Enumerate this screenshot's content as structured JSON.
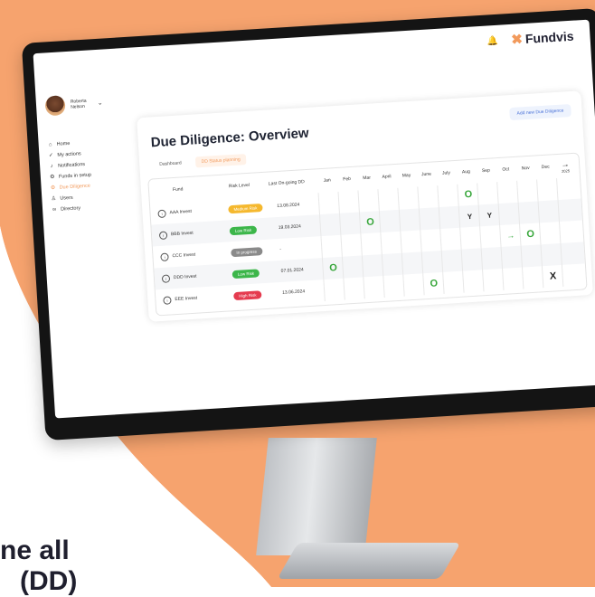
{
  "colors": {
    "background_orange": "#f6a36e",
    "accent": "#f29a5c",
    "badge_medium": "#f5b82e",
    "badge_low": "#3cb64a",
    "badge_progress": "#8a8a8a",
    "badge_high": "#e53b4f",
    "marker_green": "#37a63a"
  },
  "header": {
    "bell_icon": "bell-icon",
    "logo_text": "Fundvis"
  },
  "user": {
    "first_name": "Roberta",
    "last_name": "Nelson"
  },
  "sidebar": {
    "items": [
      {
        "label": "Home",
        "icon": "home-icon"
      },
      {
        "label": "My actions",
        "icon": "check-circle-icon"
      },
      {
        "label": "Notifications",
        "icon": "bell-icon"
      },
      {
        "label": "Funds in setup",
        "icon": "gear-icon"
      },
      {
        "label": "Due Diligence",
        "icon": "gear-icon",
        "active": true
      },
      {
        "label": "Users",
        "icon": "users-icon"
      },
      {
        "label": "Directory",
        "icon": "link-icon"
      }
    ]
  },
  "main": {
    "title": "Due Diligence: Overview",
    "add_button": "Add new Due Diligence",
    "tabs": [
      "Dashboard",
      "DD Status planning"
    ],
    "table": {
      "headers": [
        "Fund",
        "Risk Level",
        "Last On-going DD"
      ],
      "months": [
        "Jan",
        "Feb",
        "Mar",
        "April",
        "May",
        "June",
        "July",
        "Aug",
        "Sep",
        "Oct",
        "Nov",
        "Dec"
      ],
      "next_year": "2025",
      "rows": [
        {
          "fund": "AAA Invest",
          "risk": "Medium Risk",
          "risk_color": "#f5b82e",
          "date": "13.08.2024",
          "marks": {
            "7": "O"
          }
        },
        {
          "fund": "BBB Invest",
          "risk": "Low Risk",
          "risk_color": "#3cb64a",
          "date": "19.03.2024",
          "marks": {
            "2": "O",
            "7": "Y",
            "8": "Y"
          }
        },
        {
          "fund": "CCC Invest",
          "risk": "In progress",
          "risk_color": "#8a8a8a",
          "date": "-",
          "marks": {
            "9": "→",
            "10": "O"
          }
        },
        {
          "fund": "DDD Invest",
          "risk": "Low Risk",
          "risk_color": "#3cb64a",
          "date": "07.01.2024",
          "marks": {
            "0": "O"
          }
        },
        {
          "fund": "EEE Invest",
          "risk": "High Risk",
          "risk_color": "#e53b4f",
          "date": "13.06.2024",
          "marks": {
            "5": "O",
            "11": "X"
          }
        }
      ]
    }
  },
  "caption": {
    "line1": "ne all",
    "line2": "(DD)"
  }
}
